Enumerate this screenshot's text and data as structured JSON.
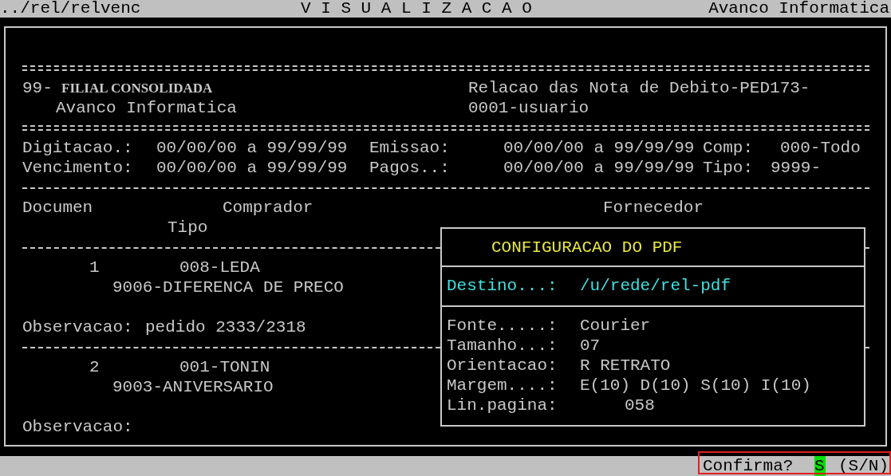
{
  "header_bar": {
    "path": "../rel/relvenc",
    "title": "V I S U A L I Z A C A O",
    "company": "Avanco Informatica"
  },
  "report": {
    "branch_code": "99-",
    "branch_name": "FILIAL CONSOLIDADA",
    "company": "Avanco Informatica",
    "report_title": "Relacao das Nota de Debito-PED173-",
    "user": "0001-usuario",
    "filters": [
      [
        {
          "label": "Digitacao.:",
          "value": "00/00/00 a 99/99/99"
        },
        {
          "label": "Emissao:",
          "value": "00/00/00 a 99/99/99"
        },
        {
          "label": "Comp:",
          "value": "000-Todo"
        }
      ],
      [
        {
          "label": "Vencimento:",
          "value": "00/00/00 a 99/99/99"
        },
        {
          "label": "Pagos..:",
          "value": "00/00/00 a 99/99/99"
        },
        {
          "label": "Tipo:",
          "value": "9999-"
        }
      ]
    ],
    "columns": {
      "document": "Documen",
      "buyer": "Comprador",
      "supplier": "Fornecedor",
      "type": "Tipo"
    },
    "rows": [
      {
        "document": "1",
        "buyer": "008-LEDA",
        "type": "9006-DIFERENCA DE PRECO",
        "note_label": "Observacao:",
        "note": "pedido 2333/2318"
      },
      {
        "document": "2",
        "buyer": "001-TONIN",
        "type": "9003-ANIVERSARIO",
        "note_label": "Observacao:"
      }
    ]
  },
  "pdf_dialog": {
    "title": "CONFIGURACAO DO PDF",
    "destination": {
      "label": "Destino...:",
      "value": "/u/rede/rel-pdf"
    },
    "fields": [
      {
        "label": "Fonte.....:",
        "value": "Courier"
      },
      {
        "label": "Tamanho...:",
        "value": "07"
      },
      {
        "label": "Orientacao:",
        "value": "R RETRATO"
      },
      {
        "label": "Margem....:",
        "value": "E(10) D(10) S(10) I(10)"
      },
      {
        "label": "Lin.pagina:",
        "value": "058"
      }
    ]
  },
  "status_bar": {
    "prompt": "Confirma?",
    "answer": "S",
    "options": "(S/N)"
  }
}
